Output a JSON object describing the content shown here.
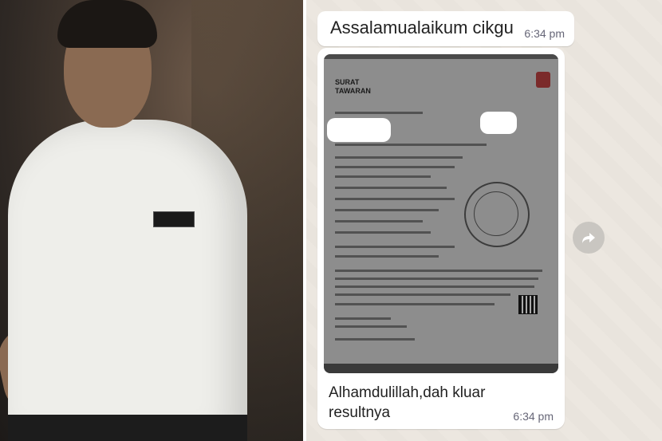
{
  "message1": {
    "text": "Assalamualaikum cikgu",
    "time": "6:34 pm"
  },
  "message2": {
    "text": "Alhamdulillah,dah kluar resultnya",
    "time": "6:34 pm",
    "document": {
      "title": "SURAT TAWARAN"
    }
  },
  "icons": {
    "forward": "forward-arrow-icon"
  },
  "colors": {
    "bubble": "#ffffff",
    "chat_bg": "#e9e4dd",
    "forward_button": "#c9c6c1"
  }
}
